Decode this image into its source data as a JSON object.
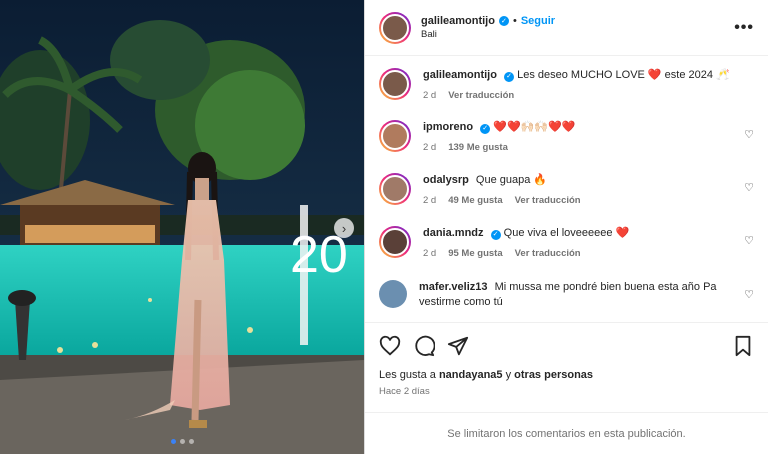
{
  "post": {
    "author": "galileamontijo",
    "follow_label": "Seguir",
    "location": "Bali",
    "more_label": "•••"
  },
  "caption": {
    "username": "galileamontijo",
    "text": "Les deseo MUCHO LOVE ❤️ este 2024 🥂",
    "time": "2 d",
    "translate": "Ver traducción"
  },
  "comments": [
    {
      "username": "ipmoreno",
      "text": "❤️❤️🙌🏻🙌🏻❤️❤️",
      "time": "2 d",
      "likes": "139 Me gusta",
      "translate": ""
    },
    {
      "username": "odalysrp",
      "text": "Que guapa 🔥",
      "time": "2 d",
      "likes": "49 Me gusta",
      "translate": "Ver traducción"
    },
    {
      "username": "dania.mndz",
      "text": "Que viva el loveeeeee ❤️",
      "time": "2 d",
      "likes": "95 Me gusta",
      "translate": "Ver traducción"
    },
    {
      "username": "mafer.veliz13",
      "text": "Mi mussa me pondré bien buena esta año Pa vestirme como tú",
      "time": "",
      "likes": "",
      "translate": ""
    }
  ],
  "footer": {
    "likes_prefix": "Les gusta a ",
    "likes_user": "nandayana5",
    "likes_mid": " y ",
    "likes_others": "otras personas",
    "ago": "Hace 2 días",
    "limited": "Se limitaron los comentarios en esta publicación."
  },
  "photo": {
    "number_text": "20",
    "arrow": "›"
  },
  "colors": {
    "accent": "#0095f6",
    "like": "#ed4956"
  }
}
